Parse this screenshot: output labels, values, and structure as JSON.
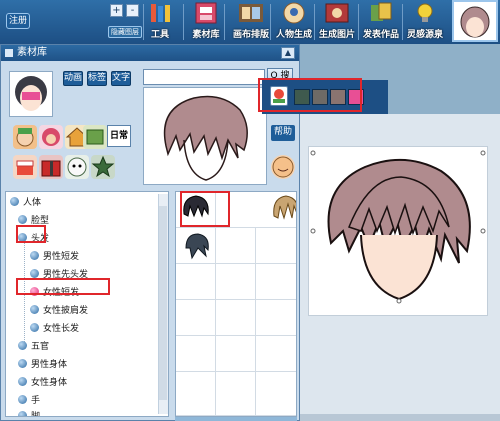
{
  "toolbar": {
    "register_label": "注册",
    "mini_label": "隐藏图层",
    "mini_plus": "+",
    "mini_minus": "-",
    "tools": [
      {
        "label": "工具",
        "icon": "tools-icon",
        "color": "#e85a3a"
      },
      {
        "label": "素材库",
        "icon": "material-library-icon",
        "color": "#d84a6a"
      },
      {
        "label": "画布排版",
        "icon": "canvas-layout-icon",
        "color": "#c8843a"
      },
      {
        "label": "人物生成",
        "icon": "character-generate-icon",
        "color": "#d8a04a"
      },
      {
        "label": "生成图片",
        "icon": "generate-image-icon",
        "color": "#b23a3a"
      },
      {
        "label": "发表作品",
        "icon": "publish-work-icon",
        "color": "#6aa04a"
      },
      {
        "label": "灵感源泉",
        "icon": "inspiration-bulb-icon",
        "color": "#f2d23a"
      }
    ]
  },
  "panel": {
    "title": "素材库",
    "tags": [
      "动画",
      "标签",
      "文字"
    ],
    "search_button": "Q 搜",
    "daily_label": "日常",
    "help_label": "帮助"
  },
  "tree": {
    "items": [
      {
        "label": "人体",
        "level": 0,
        "dot": "blue"
      },
      {
        "label": "脸型",
        "level": 1,
        "dot": "blue"
      },
      {
        "label": "头发",
        "level": 1,
        "dot": "blue"
      },
      {
        "label": "男性短发",
        "level": 2,
        "dot": "blue"
      },
      {
        "label": "男性先头发",
        "level": 2,
        "dot": "blue"
      },
      {
        "label": "女性短发",
        "level": 2,
        "dot": "pink"
      },
      {
        "label": "女性披肩发",
        "level": 2,
        "dot": "blue"
      },
      {
        "label": "女性长发",
        "level": 2,
        "dot": "blue"
      },
      {
        "label": "五官",
        "level": 1,
        "dot": "blue"
      },
      {
        "label": "男性身体",
        "level": 1,
        "dot": "blue"
      },
      {
        "label": "女性身体",
        "level": 1,
        "dot": "blue"
      },
      {
        "label": "手",
        "level": 1,
        "dot": "blue"
      },
      {
        "label": "脚",
        "level": 1,
        "dot": "blue"
      }
    ]
  },
  "palette": {
    "colors": [
      "#3f5a4e",
      "#6e6a66",
      "#8a7470",
      "#e84f95"
    ]
  },
  "colors": {
    "hair": "#b08b8e",
    "hair_dark": "#3a3a44",
    "hair_blonde": "#c9a572",
    "accent_blue": "#1d4f84",
    "highlight_red": "#e0262b"
  }
}
